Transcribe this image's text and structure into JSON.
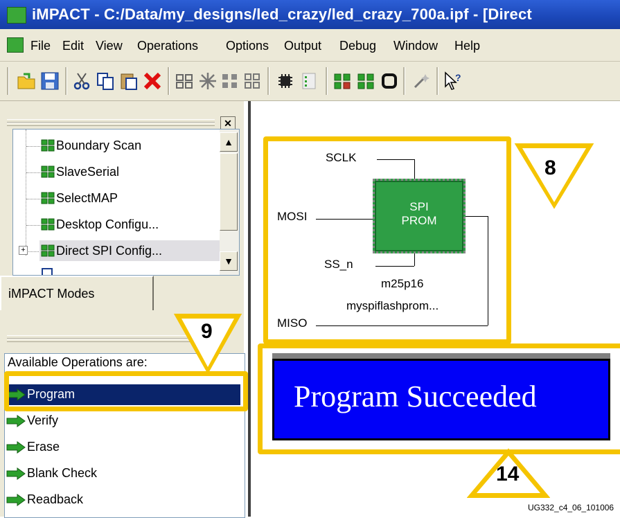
{
  "window": {
    "title": "iMPACT - C:/Data/my_designs/led_crazy/led_crazy_700a.ipf - [Direct"
  },
  "menu": [
    "File",
    "Edit",
    "View",
    "Operations",
    "Options",
    "Output",
    "Debug",
    "Window",
    "Help"
  ],
  "toolbar_icons": [
    "open-icon",
    "save-icon",
    "cut-icon",
    "copy-icon",
    "paste-icon",
    "delete-icon",
    "chain-icon",
    "config-icon",
    "grid-icon",
    "grid2-icon",
    "chip-icon",
    "file-icon",
    "program-icon",
    "verify-icon",
    "cycle-icon",
    "wand-icon",
    "help-icon"
  ],
  "modes_tree": {
    "items": [
      "Boundary Scan",
      "SlaveSerial",
      "SelectMAP",
      "Desktop Configu...",
      "Direct SPI Config..."
    ]
  },
  "modes_tab": {
    "label": "iMPACT Modes"
  },
  "operations": {
    "header": "Available Operations are:",
    "items": [
      "Program",
      "Verify",
      "Erase",
      "Blank Check",
      "Readback"
    ]
  },
  "diagram": {
    "signals": {
      "sclk": "SCLK",
      "mosi": "MOSI",
      "ss_n": "SS_n",
      "miso": "MISO"
    },
    "chip": {
      "line1": "SPI",
      "line2": "PROM",
      "color": "#2e9e45"
    },
    "part": "m25p16",
    "instance": "myspiflashprom..."
  },
  "status": {
    "text": "Program Succeeded",
    "color": "#0000f8"
  },
  "callouts": {
    "c8": "8",
    "c9": "9",
    "c14": "14",
    "color": "#f5c400"
  },
  "footnote": "UG332_c4_06_101006"
}
